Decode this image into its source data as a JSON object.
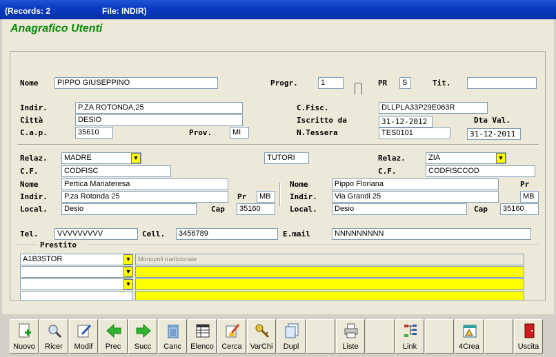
{
  "window": {
    "records": "(Records: 2",
    "file": "File: INDIR)"
  },
  "app_title": "Anagrafico Utenti",
  "labels": {
    "nome": "Nome",
    "progr": "Progr.",
    "pr": "PR",
    "tit": "Tit.",
    "indir": "Indir.",
    "citta": "Città",
    "cap": "C.a.p.",
    "prov": "Prov.",
    "cfisc": "C.Fisc.",
    "iscritto": "Iscritto da",
    "dta_val": "Dta Val.",
    "ntessera": "N.Tessera",
    "relaz": "Relaz.",
    "cf": "C.F.",
    "nome2": "Nome",
    "indir2": "Indir.",
    "pr2": "Pr",
    "local": "Local.",
    "cap2": "Cap",
    "tel": "Tel.",
    "cell": "Cell.",
    "email": "E.mail",
    "prestito": "Prestito"
  },
  "user": {
    "nome": "PIPPO GIUSEPPINO",
    "progr": "1",
    "pr": "S",
    "tit": "",
    "indir": "P.ZA ROTONDA,25",
    "citta": "DESIO",
    "cap": "35610",
    "prov": "MI",
    "cfisc": "DLLPLA33P29E063R",
    "iscritto": "31-12-2012",
    "dta_val": "31-12-2011",
    "ntessera": "TES0101",
    "tel": "VVVVVVVVV",
    "cell": "3456789",
    "email": "NNNNNNNNN"
  },
  "tutori_label": "TUTORI",
  "tutore1": {
    "relaz": "MADRE",
    "cf": "CODFISC",
    "nome": "Pertica Mariateresa",
    "indir": "P.za Rotonda 25",
    "pr": "MB",
    "local": "Desio",
    "cap": "35160"
  },
  "tutore2": {
    "relaz": "ZIA",
    "cf": "CODFISCCOD",
    "nome": "Pippo Floriana",
    "indir": "Via Grandi 25",
    "pr": "MB",
    "local": "Desio",
    "cap": "35160"
  },
  "prestito": [
    {
      "code": "A1B3STOR",
      "desc": "Monopoli tradizionale"
    },
    {
      "code": "",
      "desc": ""
    },
    {
      "code": "",
      "desc": ""
    },
    {
      "code": "",
      "desc": ""
    },
    {
      "code": "",
      "desc": ""
    }
  ],
  "toolbar": {
    "nuovo": "Nuovo",
    "ricer": "Ricer",
    "modif": "Modif",
    "prec": "Prec",
    "succ": "Succ",
    "canc": "Canc",
    "elenco": "Elenco",
    "cerca": "Cerca",
    "varchi": "VarChi",
    "dupl": "Dupl",
    "liste": "Liste",
    "link": "Link",
    "crea": "4Crea",
    "uscita": "Uscita"
  },
  "colors": {
    "title_green": "#0b8a0b",
    "dropdown_yellow": "#ffff00",
    "titlebar_blue": "#0a3bc4"
  }
}
